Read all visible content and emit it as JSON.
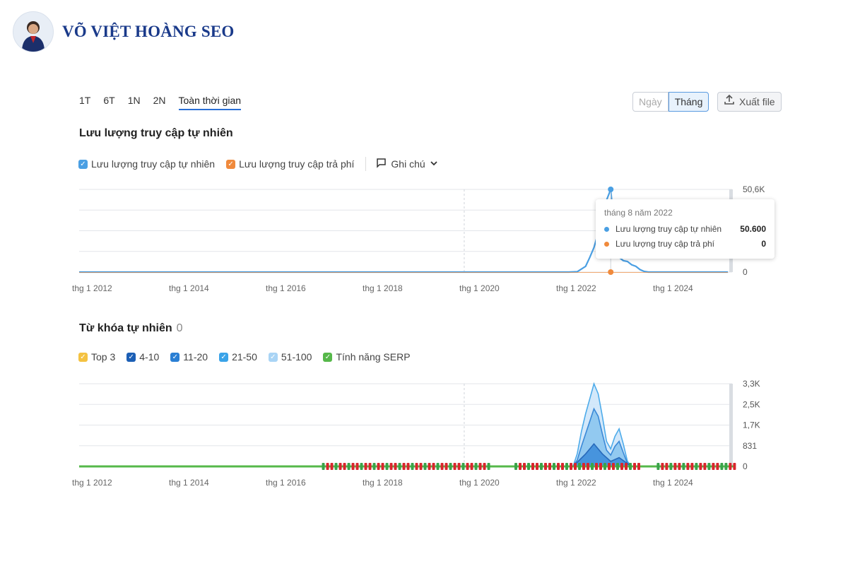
{
  "brand": {
    "name": "VÕ VIỆT HOÀNG SEO"
  },
  "periods": [
    "1T",
    "6T",
    "1N",
    "2N",
    "Toàn thời gian"
  ],
  "granularity": {
    "day": "Ngày",
    "month": "Tháng"
  },
  "export_label": "Xuất file",
  "colors": {
    "organic": "#4a9fe3",
    "paid": "#f08a3c",
    "top3": "#f4c242",
    "r4_10": "#1c5fb5",
    "r11_20": "#2a7fd4",
    "r21_50": "#3aa3e8",
    "r51_100": "#a9d4f5",
    "serp": "#56b84a"
  },
  "traffic_section": {
    "title": "Lưu lượng truy cập tự nhiên",
    "legend": [
      "Lưu lượng truy cập tự nhiên",
      "Lưu lượng truy cập trả phí"
    ],
    "note_label": "Ghi chú",
    "tooltip": {
      "title": "tháng 8 năm 2022",
      "rows": [
        {
          "label": "Lưu lượng truy cập tự nhiên",
          "value": "50.600"
        },
        {
          "label": "Lưu lượng truy cập trả phí",
          "value": "0"
        }
      ]
    }
  },
  "keywords_section": {
    "title": "Từ khóa tự nhiên",
    "count": "0",
    "legend": [
      "Top 3",
      "4-10",
      "11-20",
      "21-50",
      "51-100",
      "Tính năng SERP"
    ]
  },
  "chart_data": [
    {
      "type": "line",
      "title": "Lưu lượng truy cập tự nhiên",
      "x_tick_labels": [
        "thg 1 2012",
        "thg 1 2014",
        "thg 1 2016",
        "thg 1 2018",
        "thg 1 2020",
        "thg 1 2022",
        "thg 1 2024"
      ],
      "y_tick_labels": [
        "50,6K",
        "0"
      ],
      "ylim": [
        0,
        50600
      ],
      "grid": true,
      "series": [
        {
          "name": "Lưu lượng truy cập tự nhiên",
          "x": [
            "2012-01",
            "2021-10",
            "2021-12",
            "2022-02",
            "2022-03",
            "2022-04",
            "2022-05",
            "2022-06",
            "2022-07",
            "2022-08",
            "2022-09",
            "2022-10",
            "2022-11",
            "2022-12",
            "2023-01",
            "2023-02",
            "2023-03",
            "2023-04",
            "2023-05",
            "2023-06",
            "2024-12"
          ],
          "values": [
            0,
            0,
            200,
            3500,
            9000,
            15000,
            24000,
            33000,
            44000,
            50600,
            22000,
            9000,
            7000,
            6500,
            4500,
            3500,
            1500,
            400,
            0,
            0,
            0
          ]
        },
        {
          "name": "Lưu lượng truy cập trả phí",
          "x": [
            "2012-01",
            "2024-12"
          ],
          "values": [
            0,
            0
          ]
        }
      ]
    },
    {
      "type": "area",
      "title": "Từ khóa tự nhiên",
      "x_tick_labels": [
        "thg 1 2012",
        "thg 1 2014",
        "thg 1 2016",
        "thg 1 2018",
        "thg 1 2020",
        "thg 1 2022",
        "thg 1 2024"
      ],
      "y_tick_labels": [
        "3,3K",
        "2,5K",
        "1,7K",
        "831",
        "0"
      ],
      "ylim": [
        0,
        3300
      ],
      "grid": true,
      "series": [
        {
          "name": "51-100",
          "x": [
            "2021-11",
            "2021-12",
            "2022-01",
            "2022-02",
            "2022-03",
            "2022-04",
            "2022-05",
            "2022-06",
            "2022-07",
            "2022-08",
            "2022-09",
            "2022-10",
            "2022-11",
            "2022-12",
            "2023-01"
          ],
          "values": [
            0,
            500,
            1400,
            2100,
            2700,
            3300,
            2900,
            2000,
            1000,
            700,
            1200,
            1500,
            900,
            200,
            0
          ]
        },
        {
          "name": "21-50",
          "x": [
            "2021-11",
            "2021-12",
            "2022-01",
            "2022-02",
            "2022-03",
            "2022-04",
            "2022-05",
            "2022-06",
            "2022-07",
            "2022-08",
            "2022-09",
            "2022-10",
            "2022-11",
            "2022-12",
            "2023-01"
          ],
          "values": [
            0,
            250,
            800,
            1300,
            1800,
            2300,
            2000,
            1300,
            650,
            450,
            800,
            1000,
            550,
            120,
            0
          ]
        },
        {
          "name": "11-20",
          "x": [
            "2021-11",
            "2022-02",
            "2022-04",
            "2022-06",
            "2022-08",
            "2022-10",
            "2023-01"
          ],
          "values": [
            0,
            500,
            900,
            500,
            200,
            350,
            0
          ]
        }
      ],
      "serp_features": {
        "name": "Tính năng SERP",
        "segments": [
          [
            "2016-11",
            "2020-03"
          ],
          [
            "2020-09",
            "2023-03"
          ],
          [
            "2023-07",
            "2025-02"
          ]
        ]
      }
    }
  ]
}
